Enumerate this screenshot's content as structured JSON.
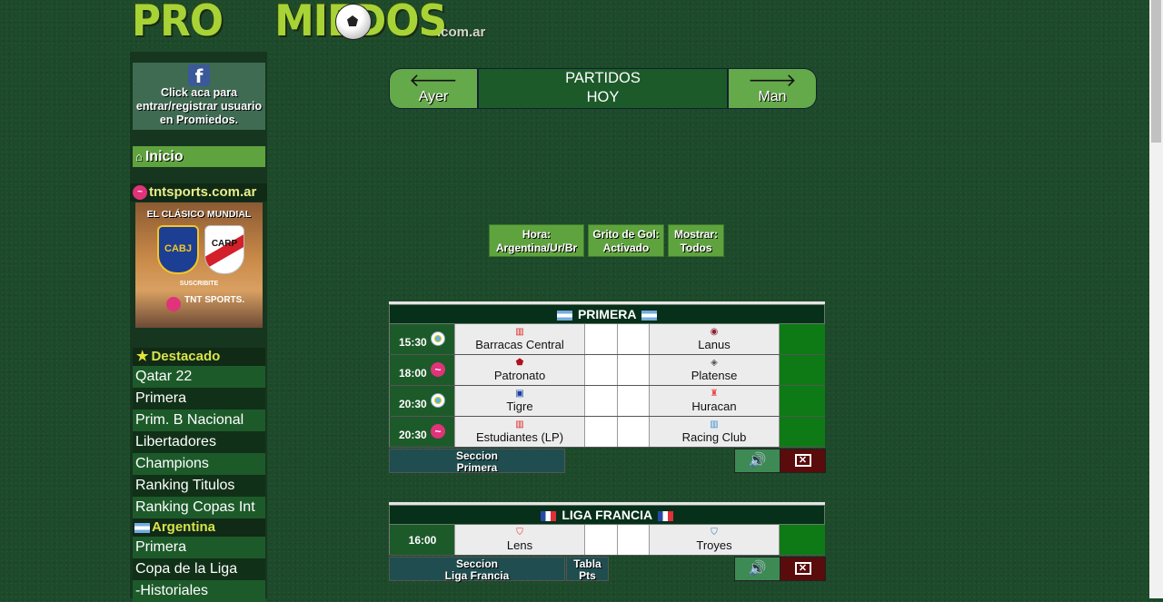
{
  "logo": {
    "text": "PROMIEDOS",
    "domain": ".com.ar"
  },
  "sidebar": {
    "facebook": {
      "icon": "facebook-icon",
      "text": "Click aca para entrar/registrar usuario en Promiedos."
    },
    "home": {
      "icon": "home-icon",
      "label": "Inicio"
    },
    "sponsor": {
      "label": "tntsports.com.ar"
    },
    "promo": {
      "headline": "EL CLÁSICO MUNDIAL",
      "team1": "CABJ",
      "team2": "CARP",
      "cta": "SUSCRIBITE",
      "brand": "TNT SPORTS."
    },
    "destacado": {
      "title": "Destacado",
      "items": [
        "Qatar 22",
        "Primera",
        "Prim. B Nacional",
        "Libertadores",
        "Champions",
        "Ranking Titulos",
        "Ranking Copas Int"
      ]
    },
    "argentina": {
      "title": "Argentina",
      "items": [
        "Primera",
        "Copa de la Liga",
        "-Historiales"
      ]
    }
  },
  "nav": {
    "prev": {
      "icon": "arrow-left-icon",
      "label": "Ayer"
    },
    "title_line1": "PARTIDOS",
    "title_line2": "HOY",
    "next": {
      "icon": "arrow-right-icon",
      "label": "Man"
    }
  },
  "options": [
    {
      "line1": "Hora:",
      "line2": "Argentina/Ur/Br"
    },
    {
      "line1": "Grito de Gol:",
      "line2": "Activado"
    },
    {
      "line1": "Mostrar:",
      "line2": "Todos"
    }
  ],
  "leagues": [
    {
      "name": "PRIMERA",
      "flag": "argentina",
      "matches": [
        {
          "time": "15:30",
          "channel": "tyc-icon",
          "home": "Barracas Central",
          "away": "Lanus"
        },
        {
          "time": "18:00",
          "channel": "tnt-icon",
          "home": "Patronato",
          "away": "Platense"
        },
        {
          "time": "20:30",
          "channel": "tyc-icon",
          "home": "Tigre",
          "away": "Huracan"
        },
        {
          "time": "20:30",
          "channel": "tnt-icon",
          "home": "Estudiantes (LP)",
          "away": "Racing Club"
        }
      ],
      "footer": {
        "section_line1": "Seccion",
        "section_line2": "Primera"
      }
    },
    {
      "name": "LIGA FRANCIA",
      "flag": "france",
      "matches": [
        {
          "time": "16:00",
          "channel": "",
          "home": "Lens",
          "away": "Troyes"
        }
      ],
      "footer": {
        "section_line1": "Seccion",
        "section_line2": "Liga Francia",
        "table_line1": "Tabla",
        "table_line2": "Pts"
      }
    }
  ],
  "colors": {
    "background": "#1d4a2a",
    "accent_green": "#5fa33e",
    "header_dark": "#07301a",
    "match_green": "#0e7a16"
  }
}
